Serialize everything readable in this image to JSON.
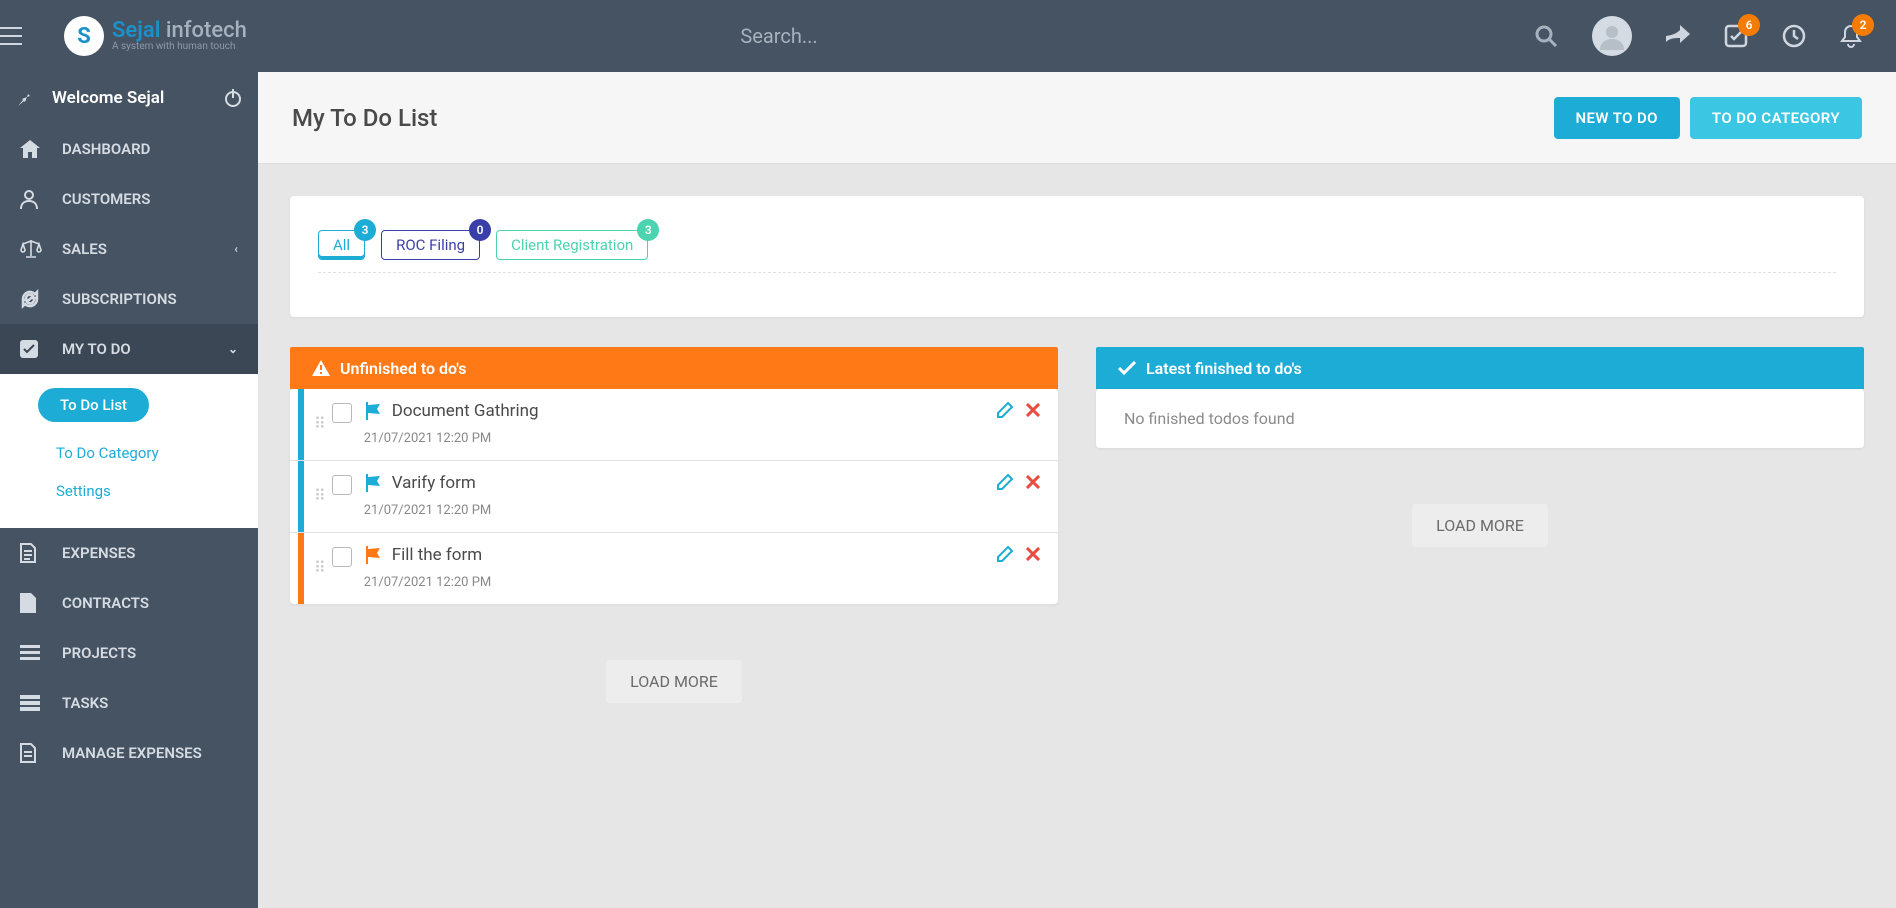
{
  "brand": {
    "name1": "Sejal",
    "name2": "infotech",
    "tagline": "A system with human touch"
  },
  "search": {
    "placeholder": "Search..."
  },
  "topbar": {
    "check_badge": "6",
    "bell_badge": "2"
  },
  "welcome": "Welcome Sejal",
  "nav": {
    "dashboard": "DASHBOARD",
    "customers": "CUSTOMERS",
    "sales": "SALES",
    "subscriptions": "SUBSCRIPTIONS",
    "mytodo": "MY TO DO",
    "expenses": "EXPENSES",
    "contracts": "CONTRACTS",
    "projects": "PROJECTS",
    "tasks": "TASKS",
    "manage_expenses": "MANAGE EXPENSES"
  },
  "subnav": {
    "todo_list": "To Do List",
    "todo_category": "To Do Category",
    "settings": "Settings"
  },
  "page": {
    "title": "My To Do List",
    "btn_new": "NEW TO DO",
    "btn_cat": "TO DO CATEGORY"
  },
  "tabs": {
    "all": {
      "label": "All",
      "count": "3"
    },
    "roc": {
      "label": "ROC Filing",
      "count": "0"
    },
    "client": {
      "label": "Client Registration",
      "count": "3"
    }
  },
  "panels": {
    "unfinished": "Unfinished to do's",
    "finished": "Latest finished to do's",
    "empty_finished": "No finished todos found"
  },
  "todos": [
    {
      "title": "Document Gathring",
      "time": "21/07/2021 12:20 PM",
      "color": "blue"
    },
    {
      "title": "Varify form",
      "time": "21/07/2021 12:20 PM",
      "color": "blue"
    },
    {
      "title": "Fill the form",
      "time": "21/07/2021 12:20 PM",
      "color": "orange"
    }
  ],
  "loadmore": "LOAD MORE"
}
